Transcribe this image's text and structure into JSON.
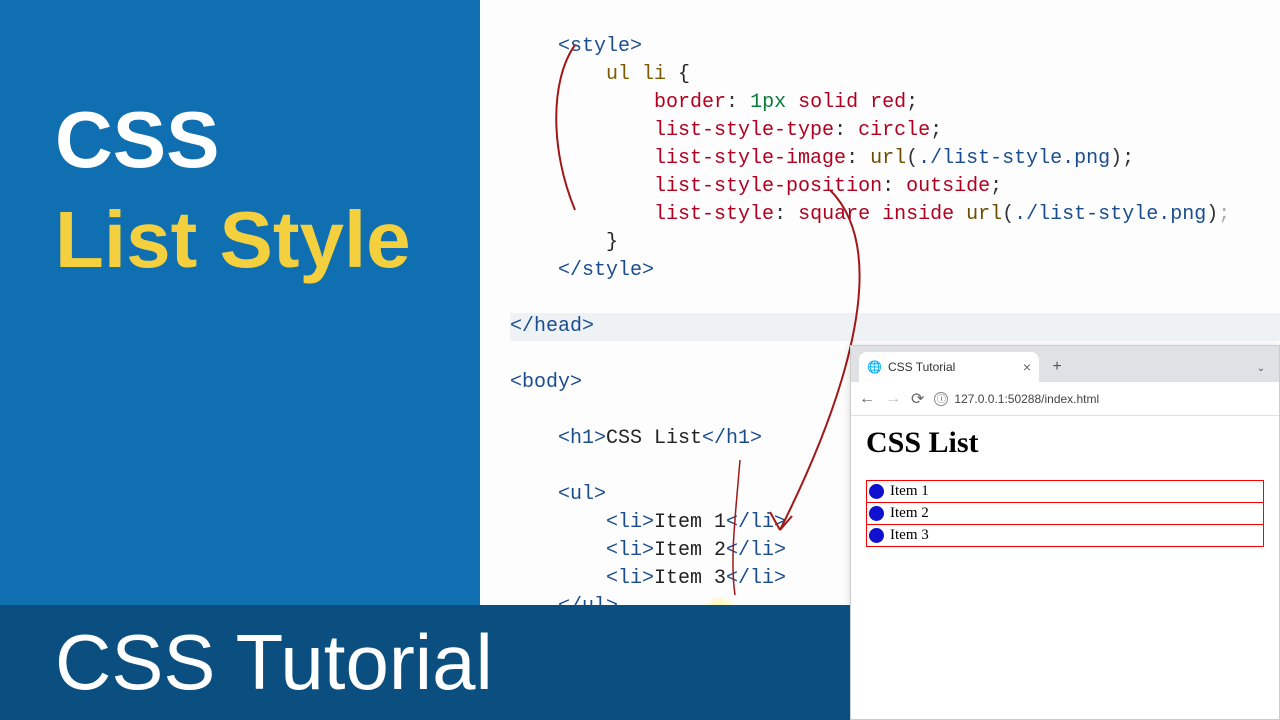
{
  "left": {
    "line1": "CSS",
    "line2": "List Style"
  },
  "bottom": {
    "label": "CSS Tutorial"
  },
  "code": {
    "style_open": "<style>",
    "selector": "ul li",
    "brace_open": "{",
    "p1": "border",
    "v1a": "1px",
    "v1b": "solid",
    "v1c": "red",
    "p2": "list-style-type",
    "v2": "circle",
    "p3": "list-style-image",
    "v3fn": "url",
    "v3arg": "./list-style.png",
    "p4": "list-style-position",
    "v4": "outside",
    "p5": "list-style",
    "v5a": "square",
    "v5b": "inside",
    "v5fn": "url",
    "v5arg": "./list-style.png",
    "brace_close": "}",
    "style_close": "</style>",
    "head_close": "</head>",
    "body_open": "<body>",
    "h1_open": "<h1>",
    "h1_text": "CSS List",
    "h1_close": "</h1>",
    "ul_open": "<ul>",
    "li1_open": "<li>",
    "li1_text": "Item 1",
    "li1_close": "</li>",
    "li2_open": "<li>",
    "li2_text": "Item 2",
    "li2_close": "</li>",
    "li3_open": "<li>",
    "li3_text": "Item 3",
    "li3_close": "</li>",
    "ul_close": "</ul>"
  },
  "browser": {
    "tab_title": "CSS Tutorial",
    "url": "127.0.0.1:50288/index.html",
    "info_icon": "ⓘ",
    "page_heading": "CSS List",
    "items": [
      "Item 1",
      "Item 2",
      "Item 3"
    ]
  }
}
